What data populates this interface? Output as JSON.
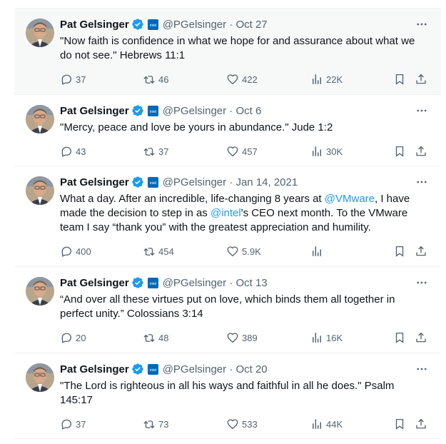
{
  "tweets": [
    {
      "name": "Pat Gelsinger",
      "handle_time": "@PGelsinger · Oct 27",
      "text": "\"Now faith is confidence in what we hope for and assurance about what we do not see.\" Hebrews 11:1",
      "replies": "37",
      "retweets": "46",
      "likes": "422",
      "views": "22K"
    },
    {
      "name": "Pat Gelsinger",
      "handle_time": "@PGelsinger · Oct 6",
      "text": "\"Mercy, peace and love be yours in abundance.\" Jude 1:2",
      "replies": "43",
      "retweets": "37",
      "likes": "457",
      "views": "30K"
    },
    {
      "name": "Pat Gelsinger",
      "handle_time": "@PGelsinger · Jan 14, 2021",
      "text_parts": {
        "p1": "What a day. After an incredible, life-changing 8 years at ",
        "link1": "@VMware",
        "p2": ", I have made the decision to step in as ",
        "link2": "@intel",
        "p3": "'s  CEO next month. To the VMware team I say “thank you” with the greatest appreciation and humility."
      },
      "replies": "400",
      "retweets": "454",
      "likes": "5.9K",
      "views": ""
    },
    {
      "name": "Pat Gelsinger",
      "handle_time": "@PGelsinger · Oct 13",
      "text": "“And over all these virtues put on love, which binds them all together in perfect unity.” Colossians 3:14",
      "replies": "20",
      "retweets": "48",
      "likes": "389",
      "views": "16K"
    },
    {
      "name": "Pat Gelsinger",
      "handle_time": "@PGelsinger · Oct 20",
      "text": "\"The Lord is righteous in all his ways and faithful in all he does.\" Psalm 145:17",
      "replies": "37",
      "retweets": "73",
      "likes": "533",
      "views": "44K"
    }
  ],
  "icons": {
    "more": "more-icon",
    "reply": "reply-icon",
    "retweet": "retweet-icon",
    "like": "like-icon",
    "views": "views-icon",
    "bookmark": "bookmark-icon",
    "share": "share-icon",
    "verified": "verified-badge-icon",
    "affiliate": "intel-affiliate-icon"
  },
  "colors": {
    "accent": "#1d9bf0",
    "muted": "#536471",
    "affiliate": "#0068b5"
  }
}
